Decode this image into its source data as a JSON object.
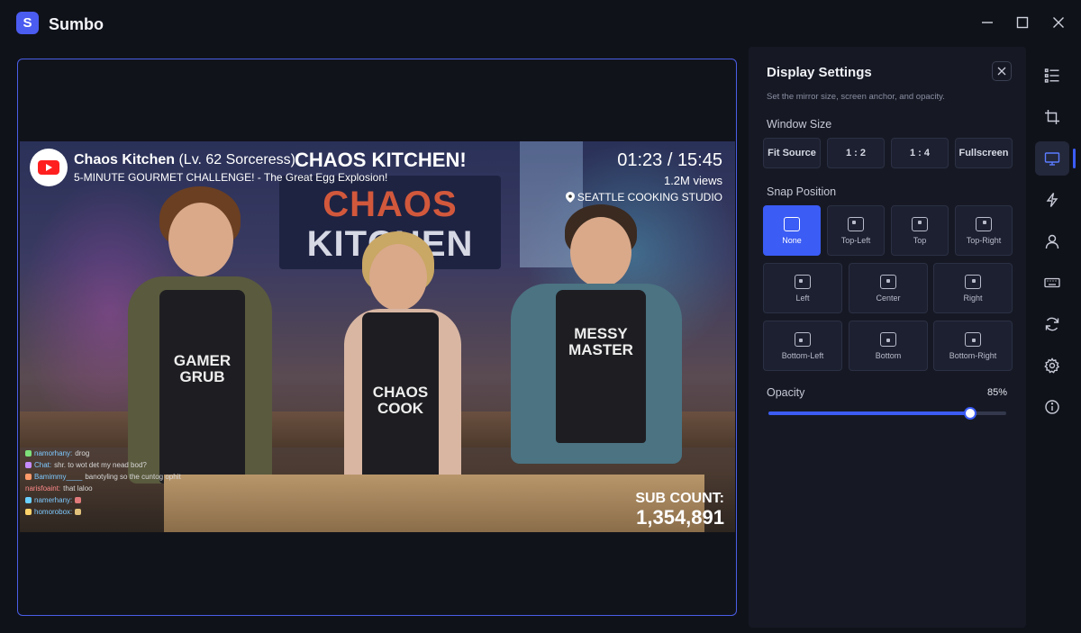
{
  "app": {
    "title": "Sumbo",
    "logo_letter": "S"
  },
  "window_controls": {
    "minimize": "minimize-icon",
    "maximize": "maximize-icon",
    "close": "close-icon"
  },
  "video": {
    "channel_name": "Chaos Kitchen",
    "channel_level": " (Lv. 62 Sorceress)",
    "subtitle": "5-MINUTE GOURMET CHALLENGE! - The Great Egg Explosion!",
    "headline": "CHAOS KITCHEN!",
    "time": "01:23 / 15:45",
    "views": "1.2M views",
    "location": "SEATTLE COOKING STUDIO",
    "sign_line1": "CHAOS",
    "sign_line2": "KITCHEN",
    "aprons": [
      "GAMER GRUB",
      "CHAOS COOK",
      "MESSY MASTER"
    ],
    "sub_count_label": "SUB COUNT:",
    "sub_count": "1,354,891",
    "chat": [
      {
        "user": "namorhany:",
        "text": "drog",
        "color": "#7ee07a"
      },
      {
        "user": "Chat:",
        "text": "shr. to wot det my nead bod?",
        "color": "#c58bff"
      },
      {
        "user": "Bamimmy____",
        "text": "banotyling so the cuntog ophit",
        "color": "#ff9a6a"
      },
      {
        "user": "narisfoaint:",
        "text": "that laloo",
        "color": "#ff6a6a"
      },
      {
        "user": "namerhany:",
        "text": "",
        "color": "#6ad0ff"
      },
      {
        "user": "homorobox:",
        "text": "",
        "color": "#ffd36a"
      }
    ]
  },
  "panel": {
    "title": "Display Settings",
    "description": "Set the mirror size, screen anchor, and opacity.",
    "window_size_label": "Window Size",
    "sizes": [
      "Fit Source",
      "1 : 2",
      "1 : 4",
      "Fullscreen"
    ],
    "snap_label": "Snap Position",
    "snap_top_row": [
      "None",
      "Top-Left",
      "Top",
      "Top-Right"
    ],
    "snap_mid_row": [
      "Left",
      "Center",
      "Right"
    ],
    "snap_bottom_row": [
      "Bottom-Left",
      "Bottom",
      "Bottom-Right"
    ],
    "selected_snap": "None",
    "opacity_label": "Opacity",
    "opacity_value": "85%",
    "opacity_fraction": 0.85
  },
  "rail": [
    "list-icon",
    "crop-icon",
    "display-icon",
    "lightning-icon",
    "user-icon",
    "keyboard-icon",
    "sync-icon",
    "gear-icon",
    "info-icon"
  ],
  "colors": {
    "accent": "#3b5cf5",
    "panel_bg": "#161924",
    "app_bg": "#10121a"
  }
}
